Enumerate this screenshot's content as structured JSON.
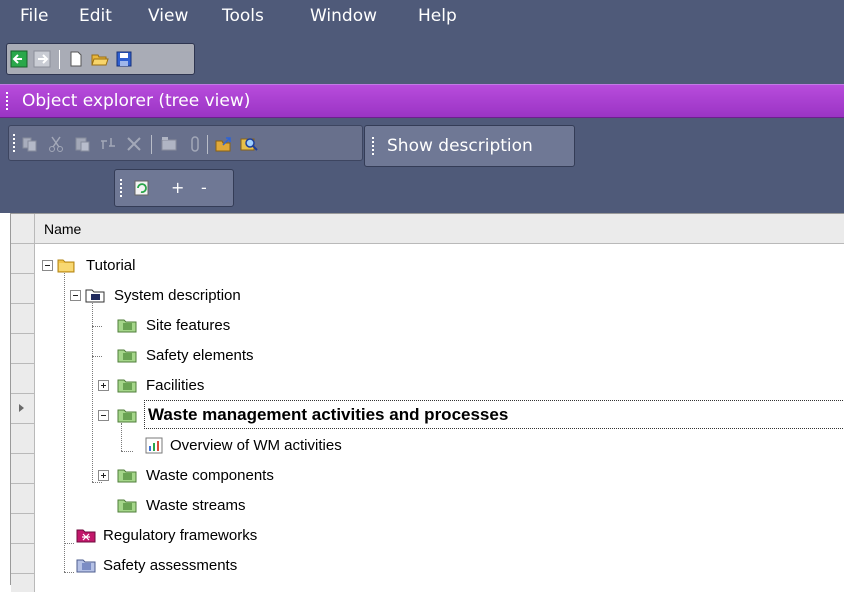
{
  "menu": [
    "File",
    "Edit",
    "View",
    "Tools",
    "Window",
    "Help"
  ],
  "toolbar_icons": [
    "back-icon",
    "forward-icon",
    "new-document-icon",
    "open-folder-icon",
    "save-icon"
  ],
  "panel": {
    "title": "Object explorer (tree view)",
    "edit_icons": [
      "copy-icon",
      "cut-icon",
      "paste-icon",
      "link-icon",
      "delete-icon",
      "properties-icon",
      "attach-icon",
      "open-icon",
      "find-icon"
    ],
    "show_description": "Show description",
    "refresh_icon": "refresh-icon",
    "expand_label": "+",
    "collapse_label": "-"
  },
  "grid": {
    "column_header": "Name",
    "selected_row": 5,
    "rows": [
      {
        "label": "Tutorial",
        "expanded": true,
        "icon": "folder-icon"
      },
      {
        "label": "System description",
        "expanded": true,
        "icon": "system-folder-icon"
      },
      {
        "label": "Site features",
        "icon": "feature-folder-icon"
      },
      {
        "label": "Safety elements",
        "icon": "feature-folder-icon"
      },
      {
        "label": "Facilities",
        "expanded": false,
        "icon": "feature-folder-icon"
      },
      {
        "label": "Waste management activities and processes",
        "expanded": true,
        "icon": "feature-folder-icon",
        "bold": true
      },
      {
        "label": "Overview of WM activities",
        "icon": "chart-icon"
      },
      {
        "label": "Waste components",
        "expanded": false,
        "icon": "feature-folder-icon"
      },
      {
        "label": "Waste streams",
        "icon": "feature-folder-icon"
      },
      {
        "label": "Regulatory frameworks",
        "icon": "regulation-icon"
      },
      {
        "label": "Safety assessments",
        "icon": "assessment-folder-icon"
      }
    ]
  }
}
